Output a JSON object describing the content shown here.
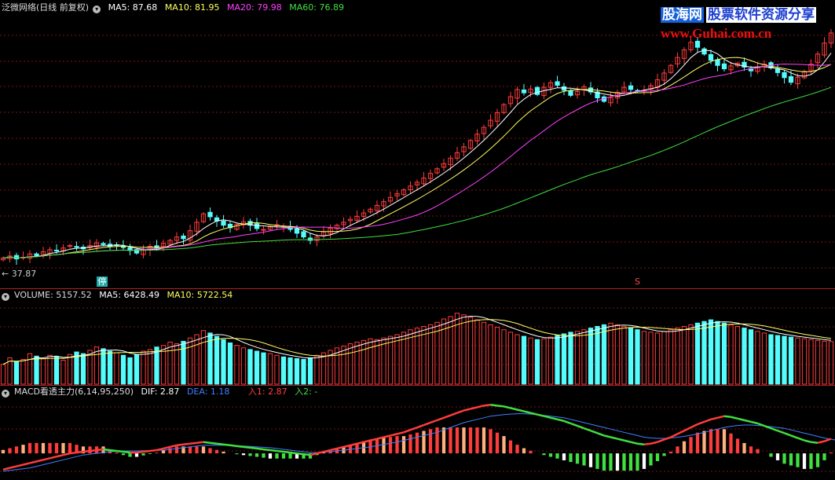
{
  "main_legend": {
    "title": "泛微网络(日线 前复权)",
    "ma5": "MA5: 87.68",
    "ma10": "MA10: 81.95",
    "ma20": "MA20: 79.98",
    "ma60": "MA60: 76.89"
  },
  "main_markers": {
    "low_price": "← 37.87",
    "halt": "停",
    "s_mark": "S"
  },
  "volume_legend": {
    "title": "VOLUME: 5157.52",
    "ma5": "MA5: 6428.49",
    "ma10": "MA10: 5722.54"
  },
  "macd_legend": {
    "title": "MACD看透主力(6,14,95,250)",
    "dif": "DIF: 2.87",
    "dea": "DEA: 1.18",
    "in1": "入1: 2.87",
    "in2": "入2: -"
  },
  "watermark": {
    "brand": "股海网",
    "slogan": "股票软件资源分享",
    "url": "www.Guhai.com.cn"
  },
  "colors": {
    "up": "#ff3c3c",
    "down": "#54fcfc",
    "ma5": "#ffffff",
    "ma10": "#ffff64",
    "ma20": "#ff40ff",
    "ma60": "#40e040",
    "dea": "#4080ff"
  },
  "series": {
    "close": [
      40,
      40.5,
      39.8,
      40.2,
      41,
      40.6,
      41.5,
      42,
      41.7,
      42.4,
      43,
      42.6,
      42.2,
      43,
      43.6,
      43.2,
      42.8,
      43.1,
      42.5,
      41.8,
      41.2,
      42,
      42.8,
      42.4,
      43.5,
      44.2,
      45,
      44.6,
      46.5,
      48.5,
      50.5,
      49.8,
      48.8,
      47.8,
      47.2,
      48,
      48.6,
      47.8,
      47,
      46.8,
      47.4,
      47.9,
      47.6,
      46.8,
      45.9,
      45,
      44.2,
      45,
      46.2,
      47.1,
      47.8,
      48.5,
      49.2,
      49.9,
      50.7,
      51.6,
      52.5,
      53.4,
      54.4,
      55.3,
      56.2,
      57.1,
      58,
      59,
      60.1,
      61.2,
      62.4,
      63.7,
      65,
      66.4,
      67.9,
      69.4,
      71,
      72.7,
      74.5,
      76.4,
      78.3,
      80,
      79.2,
      80.1,
      78.8,
      80.5,
      81.6,
      81,
      79.8,
      78.6,
      79.5,
      80.6,
      79.4,
      78,
      77.2,
      78.1,
      79.3,
      80.5,
      80,
      79.6,
      79.8,
      80.9,
      82.3,
      83.9,
      85.7,
      87.6,
      89.4,
      91.2,
      90,
      88.4,
      86.9,
      85.7,
      84.9,
      85.6,
      86.2,
      85.3,
      84.4,
      85.2,
      86,
      85.1,
      84,
      82.8,
      81.7,
      82.9,
      84.3,
      86,
      88.4,
      91,
      93.4
    ],
    "volume": [
      2400,
      3200,
      2700,
      3000,
      3700,
      3400,
      3100,
      3500,
      3300,
      2900,
      3600,
      3900,
      3700,
      4100,
      4500,
      4300,
      4000,
      3800,
      3500,
      3200,
      3600,
      4000,
      4200,
      4500,
      4700,
      5100,
      4900,
      5200,
      5600,
      6000,
      6500,
      6200,
      5800,
      5400,
      5000,
      4700,
      4400,
      4200,
      4000,
      3800,
      3700,
      3500,
      3300,
      3200,
      3100,
      3000,
      3200,
      3500,
      3800,
      4100,
      4400,
      4600,
      4900,
      5100,
      5300,
      5500,
      5400,
      5600,
      5800,
      6000,
      6300,
      6600,
      6800,
      7000,
      7200,
      7500,
      7900,
      8200,
      8600,
      8400,
      8100,
      7800,
      7500,
      7200,
      6900,
      6600,
      6300,
      6000,
      5800,
      5600,
      5400,
      5500,
      5700,
      5900,
      6100,
      6300,
      6400,
      6600,
      6800,
      7000,
      7200,
      7400,
      7200,
      7000,
      6800,
      6600,
      6400,
      6300,
      6200,
      6400,
      6600,
      6800,
      7000,
      7200,
      7400,
      7600,
      7800,
      7600,
      7400,
      7200,
      7000,
      6800,
      6600,
      6400,
      6200,
      6000,
      5900,
      5800,
      5700,
      5600,
      5500,
      5400,
      5300,
      5200,
      5157.52
    ],
    "macd_dif": [
      -2,
      -1.8,
      -1.6,
      -1.4,
      -1.2,
      -1,
      -0.8,
      -0.6,
      -0.4,
      -0.2,
      0,
      0.1,
      0.2,
      0.3,
      0.4,
      0.5,
      0.4,
      0.3,
      0.2,
      0.1,
      0.1,
      0.2,
      0.3,
      0.4,
      0.6,
      0.8,
      1,
      1.1,
      1.2,
      1.3,
      1.4,
      1.3,
      1.2,
      1.1,
      1,
      0.9,
      0.8,
      0.7,
      0.6,
      0.5,
      0.4,
      0.3,
      0.2,
      0.1,
      0,
      -0.1,
      -0.2,
      0,
      0.2,
      0.4,
      0.6,
      0.8,
      1,
      1.2,
      1.4,
      1.6,
      1.8,
      2,
      2.2,
      2.4,
      2.6,
      2.9,
      3.2,
      3.5,
      3.8,
      4.1,
      4.4,
      4.7,
      5,
      5.3,
      5.5,
      5.7,
      5.9,
      6,
      5.9,
      5.8,
      5.6,
      5.4,
      5.2,
      5,
      4.8,
      4.6,
      4.4,
      4.2,
      4,
      3.7,
      3.4,
      3.1,
      2.8,
      2.5,
      2.2,
      2,
      1.8,
      1.6,
      1.4,
      1.2,
      1.1,
      1.2,
      1.4,
      1.7,
      2,
      2.4,
      2.8,
      3.2,
      3.6,
      3.9,
      4.2,
      4.4,
      4.6,
      4.5,
      4.3,
      4.1,
      3.9,
      3.7,
      3.4,
      3.1,
      2.8,
      2.5,
      2.2,
      1.9,
      1.6,
      1.4,
      1.3,
      1.5,
      1.8,
      2.1,
      2.87
    ],
    "macd_dea": [
      -2.2,
      -2.1,
      -2,
      -1.9,
      -1.8,
      -1.6,
      -1.4,
      -1.2,
      -1,
      -0.8,
      -0.6,
      -0.4,
      -0.2,
      -0.1,
      0,
      0.1,
      0.2,
      0.25,
      0.3,
      0.3,
      0.3,
      0.32,
      0.34,
      0.36,
      0.4,
      0.5,
      0.6,
      0.7,
      0.8,
      0.9,
      1,
      1,
      1,
      1,
      1,
      0.95,
      0.9,
      0.85,
      0.8,
      0.75,
      0.7,
      0.6,
      0.5,
      0.4,
      0.3,
      0.2,
      0.1,
      0.1,
      0.15,
      0.2,
      0.3,
      0.4,
      0.5,
      0.6,
      0.7,
      0.8,
      0.95,
      1.1,
      1.25,
      1.4,
      1.6,
      1.8,
      2,
      2.2,
      2.4,
      2.6,
      2.9,
      3.2,
      3.5,
      3.8,
      4,
      4.2,
      4.4,
      4.6,
      4.7,
      4.8,
      4.85,
      4.9,
      4.9,
      4.85,
      4.8,
      4.7,
      4.6,
      4.5,
      4.4,
      4.2,
      4,
      3.8,
      3.6,
      3.4,
      3.2,
      3,
      2.8,
      2.6,
      2.4,
      2.2,
      2,
      1.9,
      1.85,
      1.85,
      1.9,
      2,
      2.1,
      2.25,
      2.4,
      2.6,
      2.8,
      3,
      3.2,
      3.35,
      3.45,
      3.5,
      3.5,
      3.45,
      3.4,
      3.3,
      3.2,
      3.1,
      2.9,
      2.7,
      2.5,
      2.3,
      2.1,
      1.9,
      1.75,
      1.6,
      1.18
    ]
  }
}
